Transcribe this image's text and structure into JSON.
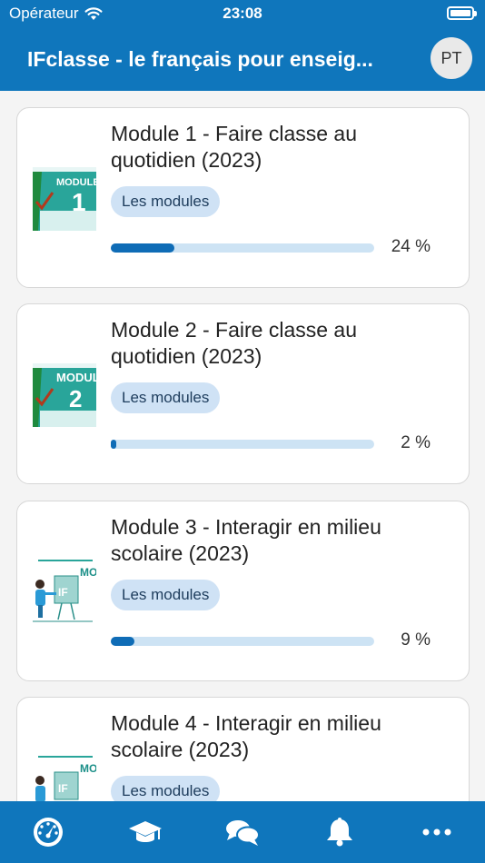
{
  "status": {
    "carrier": "Opérateur",
    "time": "23:08"
  },
  "header": {
    "title": "IFclasse - le français pour enseig...",
    "avatar_initials": "PT"
  },
  "colors": {
    "primary": "#0f76bc",
    "progress_fill": "#0f6cb6",
    "progress_track": "#cde3f4",
    "chip_bg": "#cfe2f5"
  },
  "courses": [
    {
      "title": "Module 1 - Faire classe au quotidien (2023)",
      "category": "Les modules",
      "progress": 24,
      "progress_label": "24 %",
      "thumb_text": "MODULE",
      "thumb_number": "1"
    },
    {
      "title": "Module 2 - Faire classe au quotidien (2023)",
      "category": "Les modules",
      "progress": 2,
      "progress_label": "2 %",
      "thumb_text": "MODULE",
      "thumb_number": "2"
    },
    {
      "title": "Module 3 - Interagir en milieu scolaire (2023)",
      "category": "Les modules",
      "progress": 9,
      "progress_label": "9 %",
      "thumb_text": "MO",
      "thumb_logo": "IF"
    },
    {
      "title": "Module 4 - Interagir en milieu scolaire (2023)",
      "category": "Les modules",
      "progress": null,
      "progress_label": "",
      "thumb_text": "MO",
      "thumb_logo": "IF"
    }
  ],
  "tabbar": [
    {
      "name": "dashboard-icon"
    },
    {
      "name": "courses-icon"
    },
    {
      "name": "messages-icon"
    },
    {
      "name": "notifications-icon"
    },
    {
      "name": "more-icon"
    }
  ]
}
